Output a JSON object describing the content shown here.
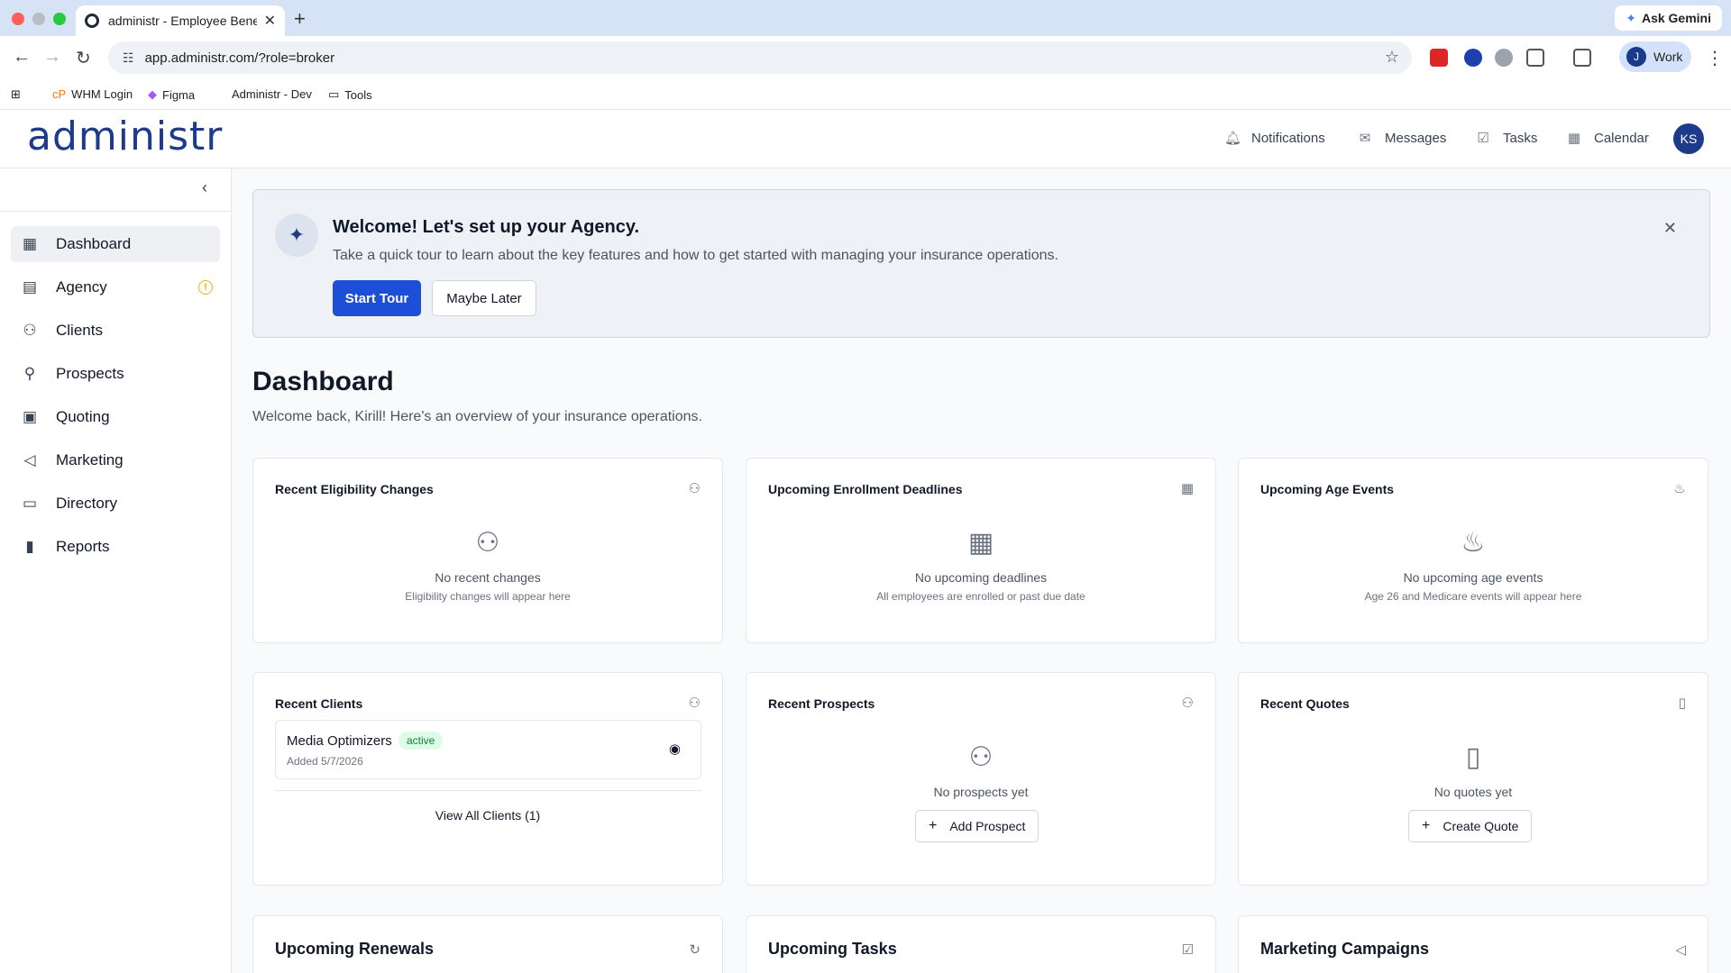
{
  "browser": {
    "tab_title": "administr - Employee Benefit",
    "url": "app.administr.com/?role=broker",
    "ask_gemini": "Ask Gemini",
    "profile_initial": "J",
    "profile_label": "Work",
    "bookmarks": [
      "WHM Login",
      "Figma",
      "Administr - Dev",
      "Tools"
    ]
  },
  "header": {
    "logo": "administr",
    "nav": [
      "Notifications",
      "Messages",
      "Tasks",
      "Calendar"
    ],
    "user_initials": "KS"
  },
  "sidebar": {
    "items": [
      {
        "label": "Dashboard",
        "icon": "grid-icon"
      },
      {
        "label": "Agency",
        "icon": "building-icon"
      },
      {
        "label": "Clients",
        "icon": "users-icon"
      },
      {
        "label": "Prospects",
        "icon": "user-plus-icon"
      },
      {
        "label": "Quoting",
        "icon": "calculator-icon"
      },
      {
        "label": "Marketing",
        "icon": "megaphone-icon"
      },
      {
        "label": "Directory",
        "icon": "folder-icon"
      },
      {
        "label": "Reports",
        "icon": "bar-chart-icon"
      }
    ]
  },
  "welcome": {
    "title": "Welcome! Let's set up your Agency.",
    "subtitle": "Take a quick tour to learn about the key features and how to get started with managing your insurance operations.",
    "start": "Start Tour",
    "later": "Maybe Later"
  },
  "page": {
    "title": "Dashboard",
    "subtitle": "Welcome back, Kirill! Here's an overview of your insurance operations."
  },
  "cards": {
    "eligibility": {
      "title": "Recent Eligibility Changes",
      "empty": "No recent changes",
      "hint": "Eligibility changes will appear here"
    },
    "enrollment": {
      "title": "Upcoming Enrollment Deadlines",
      "empty": "No upcoming deadlines",
      "hint": "All employees are enrolled or past due date"
    },
    "age": {
      "title": "Upcoming Age Events",
      "empty": "No upcoming age events",
      "hint": "Age 26 and Medicare events will appear here"
    },
    "clients": {
      "title": "Recent Clients",
      "client_name": "Media Optimizers",
      "status": "active",
      "added": "Added 5/7/2026",
      "view_all": "View All Clients (1)"
    },
    "prospects": {
      "title": "Recent Prospects",
      "empty": "No prospects yet",
      "action": "Add Prospect"
    },
    "quotes": {
      "title": "Recent Quotes",
      "empty": "No quotes yet",
      "action": "Create Quote"
    },
    "renewals": {
      "title": "Upcoming Renewals"
    },
    "tasks": {
      "title": "Upcoming Tasks"
    },
    "campaigns": {
      "title": "Marketing Campaigns"
    }
  },
  "colors": {
    "primary": "#1d4ed8",
    "logo": "#1e3a8a",
    "active_badge": "#15803d"
  }
}
